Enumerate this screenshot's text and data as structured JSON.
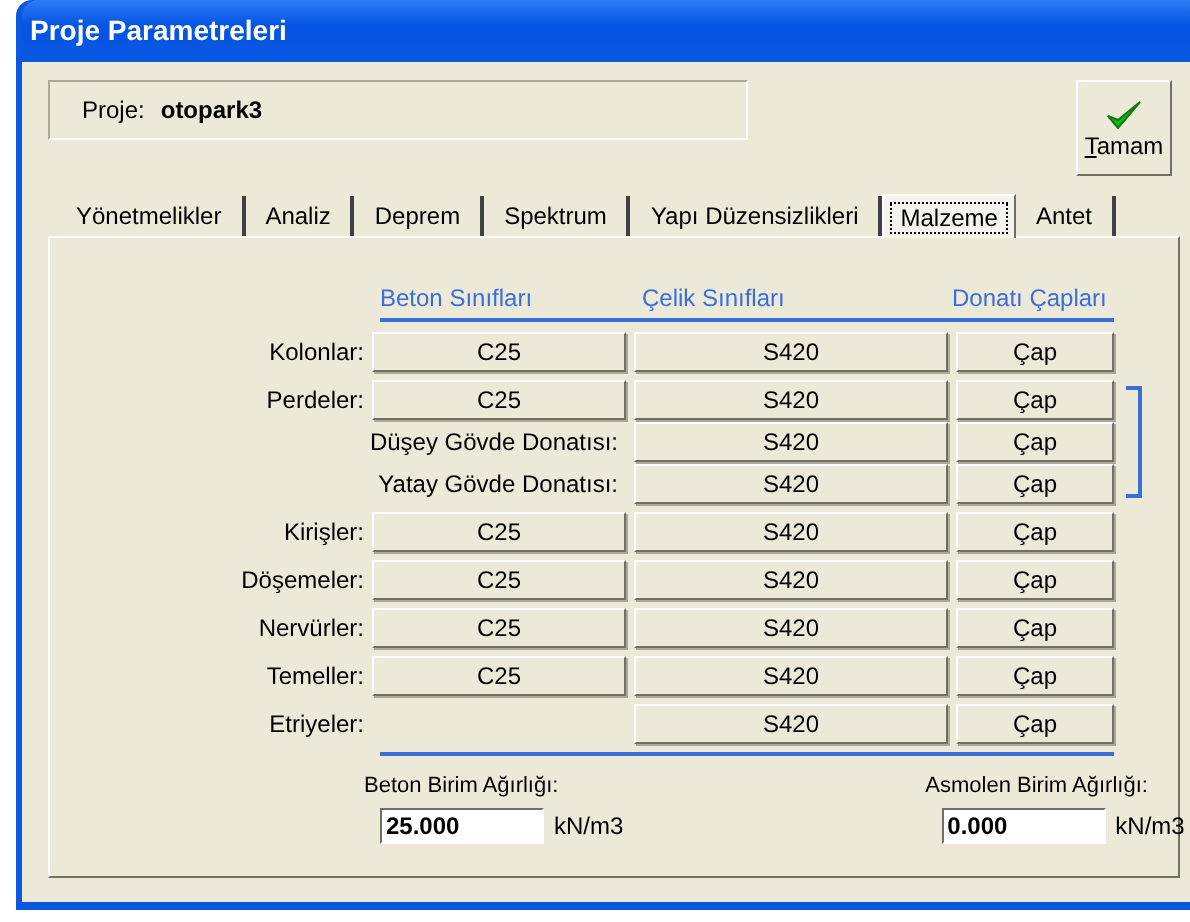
{
  "window": {
    "title": "Proje Parametreleri"
  },
  "project": {
    "label": "Proje:",
    "value": "otopark3"
  },
  "ok_button": {
    "label": "Tamam"
  },
  "tabs": [
    {
      "label": "Yönetmelikler",
      "selected": false
    },
    {
      "label": "Analiz",
      "selected": false
    },
    {
      "label": "Deprem",
      "selected": false
    },
    {
      "label": "Spektrum",
      "selected": false
    },
    {
      "label": "Yapı Düzensizlikleri",
      "selected": false
    },
    {
      "label": "Malzeme",
      "selected": true
    },
    {
      "label": "Antet",
      "selected": false
    }
  ],
  "columns": [
    "Beton Sınıfları",
    "Çelik Sınıfları",
    "Donatı Çapları"
  ],
  "rows": [
    {
      "label": "Kolonlar:",
      "concrete": "C25",
      "steel": "S420",
      "rebar": "Çap"
    },
    {
      "label": "Perdeler:",
      "concrete": "C25",
      "steel": "S420",
      "rebar": "Çap",
      "children": [
        {
          "label": "Düşey Gövde Donatısı:",
          "steel": "S420",
          "rebar": "Çap"
        },
        {
          "label": "Yatay Gövde Donatısı:",
          "steel": "S420",
          "rebar": "Çap"
        }
      ]
    },
    {
      "label": "Kirişler:",
      "concrete": "C25",
      "steel": "S420",
      "rebar": "Çap"
    },
    {
      "label": "Döşemeler:",
      "concrete": "C25",
      "steel": "S420",
      "rebar": "Çap"
    },
    {
      "label": "Nervürler:",
      "concrete": "C25",
      "steel": "S420",
      "rebar": "Çap"
    },
    {
      "label": "Temeller:",
      "concrete": "C25",
      "steel": "S420",
      "rebar": "Çap"
    },
    {
      "label": "Etriyeler:",
      "steel": "S420",
      "rebar": "Çap"
    }
  ],
  "weights": [
    {
      "label": "Beton Birim Ağırlığı:",
      "value": "25.000",
      "unit": "kN/m3"
    },
    {
      "label": "Asmolen Birim Ağırlığı:",
      "value": "0.000",
      "unit": "kN/m3"
    }
  ]
}
